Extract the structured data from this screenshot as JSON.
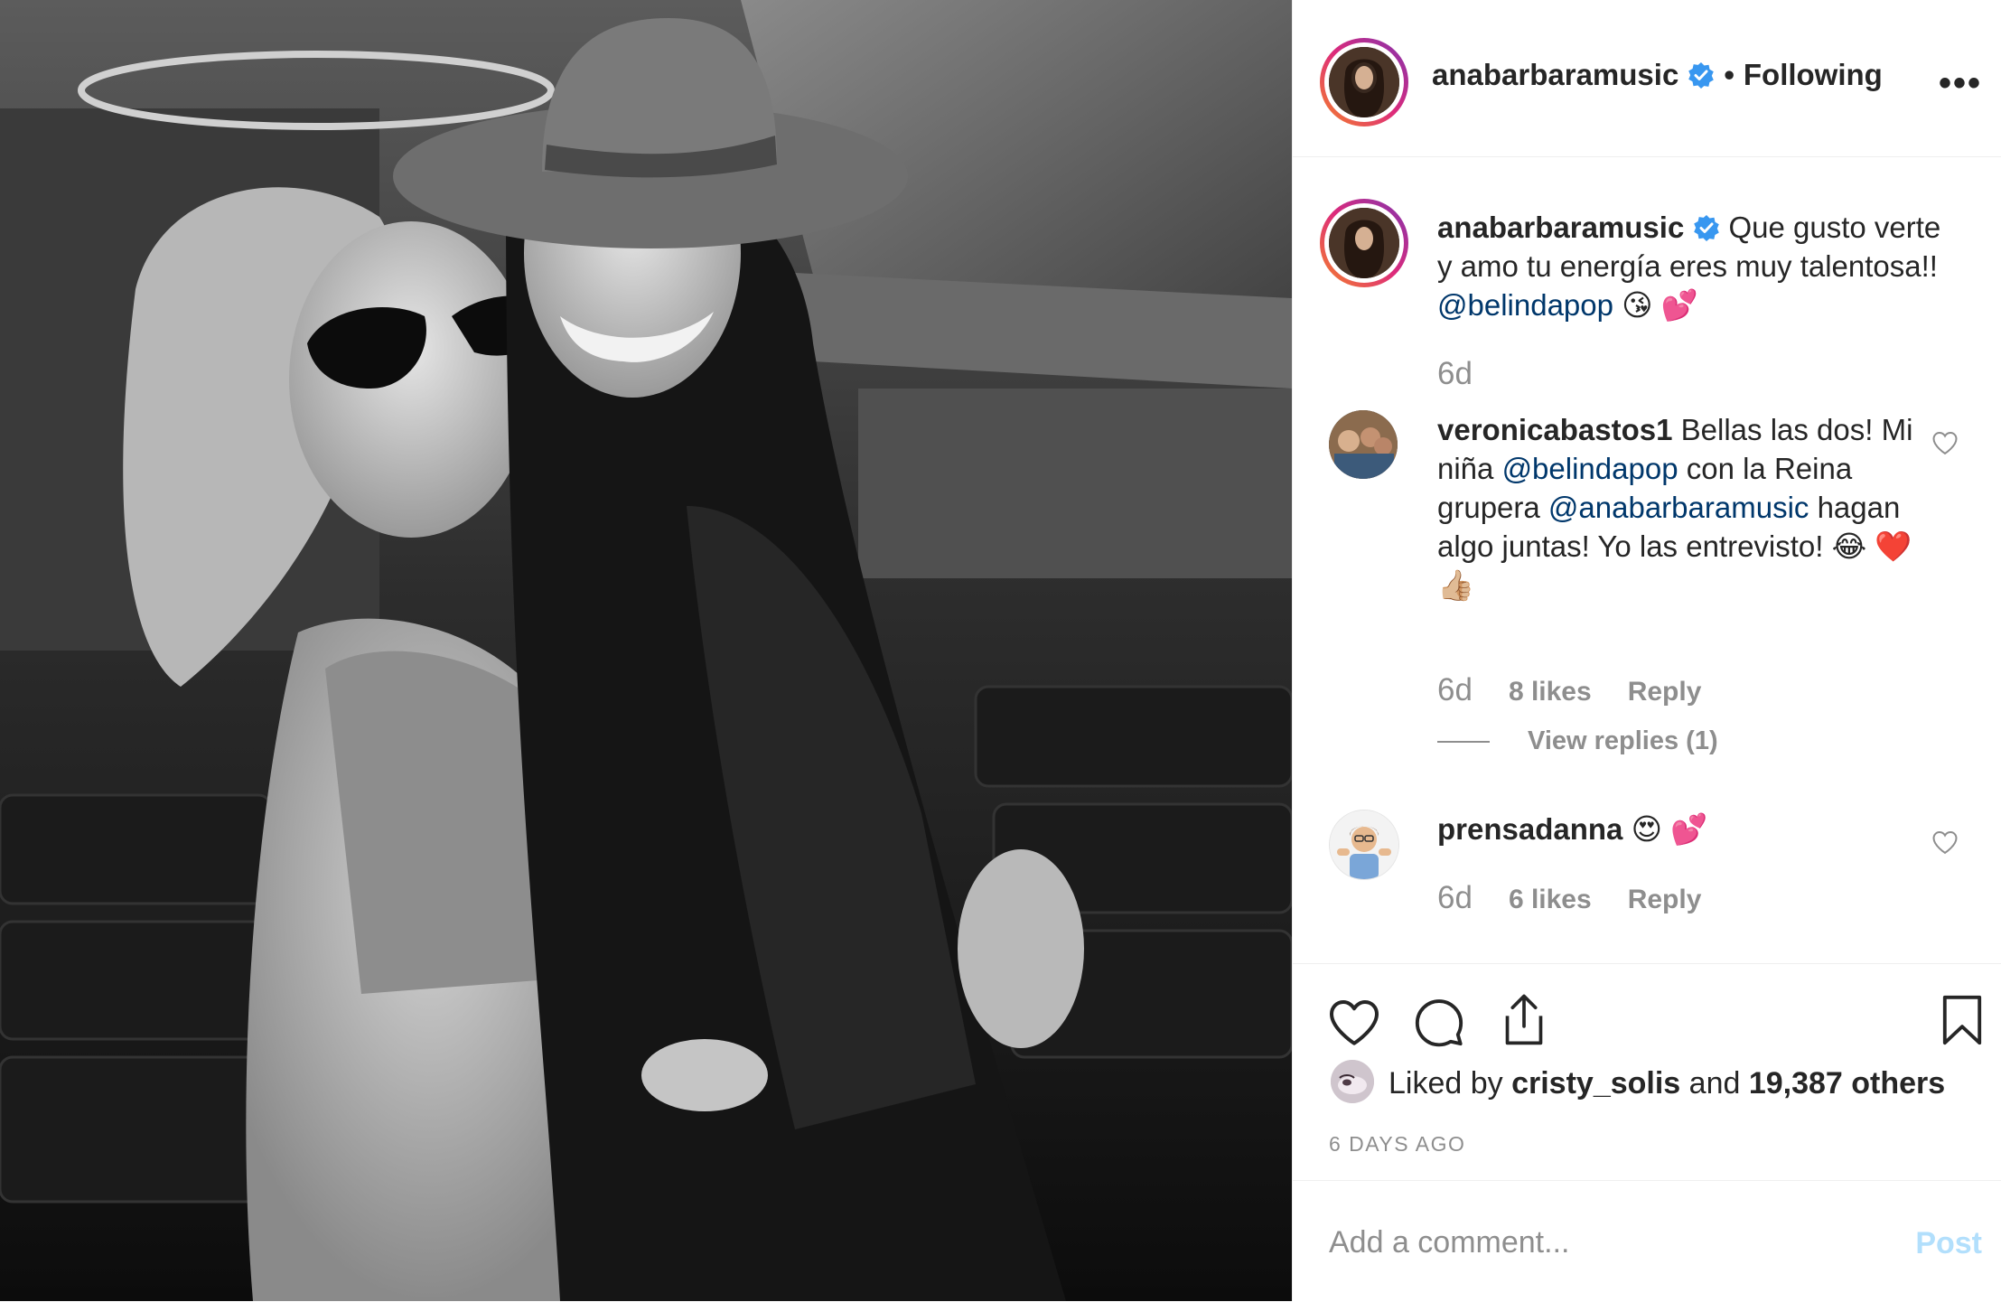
{
  "post": {
    "author": "anabarbaramusic",
    "follow_state": "Following",
    "more_icon": "more-options-icon",
    "more_label": "•••"
  },
  "caption": {
    "username": "anabarbaramusic",
    "text_before": "Que gusto verte y amo tu energía eres muy talentosa!! ",
    "mention": "@belindapop",
    "emojis": "😘 💕",
    "time": "6d"
  },
  "comments": [
    {
      "username": "veronicabastos1",
      "text_1": "Bellas las dos! Mi niña ",
      "mention_1": "@belindapop",
      "text_2": " con la Reina grupera ",
      "mention_2": "@anabarbaramusic",
      "text_3": " hagan algo juntas! Yo las entrevisto! 😂 ❤️ 👍🏼",
      "time": "6d",
      "likes": "8 likes",
      "reply": "Reply",
      "view_replies": "View replies (1)"
    },
    {
      "username": "prensadanna",
      "text": "😍 💕",
      "time": "6d",
      "likes": "6 likes",
      "reply": "Reply"
    }
  ],
  "engagement": {
    "liked_prefix": "Liked by ",
    "liked_user": "cristy_solis",
    "liked_middle": " and ",
    "liked_others": "19,387 others",
    "timestamp": "6 DAYS AGO"
  },
  "add_comment": {
    "placeholder": "Add a comment...",
    "post_label": "Post"
  },
  "colors": {
    "mention": "#00376b",
    "verified": "#3897f0",
    "muted": "#8e8e8e",
    "post_disabled": "#b2dffc"
  }
}
